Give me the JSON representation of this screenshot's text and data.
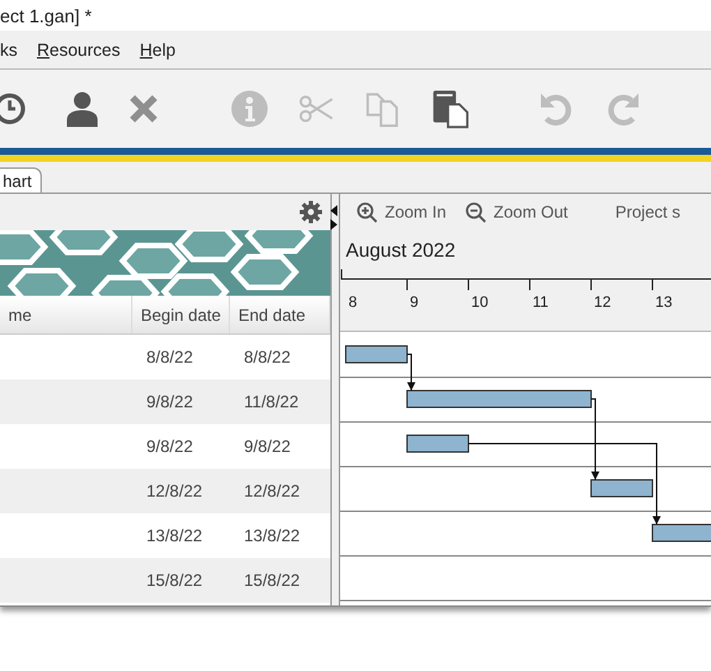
{
  "window": {
    "title": "ect 1.gan] *"
  },
  "menu": [
    {
      "label": "ks",
      "mnemonic": false
    },
    {
      "label": "Resources",
      "mnemonic": true
    },
    {
      "label": "Help",
      "mnemonic": true
    }
  ],
  "toolbar": [
    {
      "kind": "clock",
      "disabled": false
    },
    {
      "kind": "person",
      "disabled": false
    },
    {
      "kind": "delete",
      "disabled": false
    },
    {
      "kind": "info",
      "disabled": true
    },
    {
      "kind": "cut",
      "disabled": true
    },
    {
      "kind": "copy",
      "disabled": true
    },
    {
      "kind": "paste",
      "disabled": false
    },
    {
      "kind": "undo",
      "disabled": true
    },
    {
      "kind": "redo",
      "disabled": true
    }
  ],
  "tabs": [
    {
      "label": "hart",
      "selected": true
    }
  ],
  "table": {
    "columns": [
      "me",
      "Begin date",
      "End date"
    ],
    "rows": [
      {
        "begin": "8/8/22",
        "end": "8/8/22"
      },
      {
        "begin": "9/8/22",
        "end": "11/8/22"
      },
      {
        "begin": "9/8/22",
        "end": "9/8/22"
      },
      {
        "begin": "12/8/22",
        "end": "12/8/22"
      },
      {
        "begin": "13/8/22",
        "end": "13/8/22"
      },
      {
        "begin": "15/8/22",
        "end": "15/8/22"
      }
    ]
  },
  "chart_toolbar": [
    "Zoom In",
    "Zoom Out",
    "Project s"
  ],
  "timeline": {
    "month": "August 2022",
    "days": [
      "8",
      "9",
      "10",
      "11",
      "12",
      "13"
    ]
  }
}
